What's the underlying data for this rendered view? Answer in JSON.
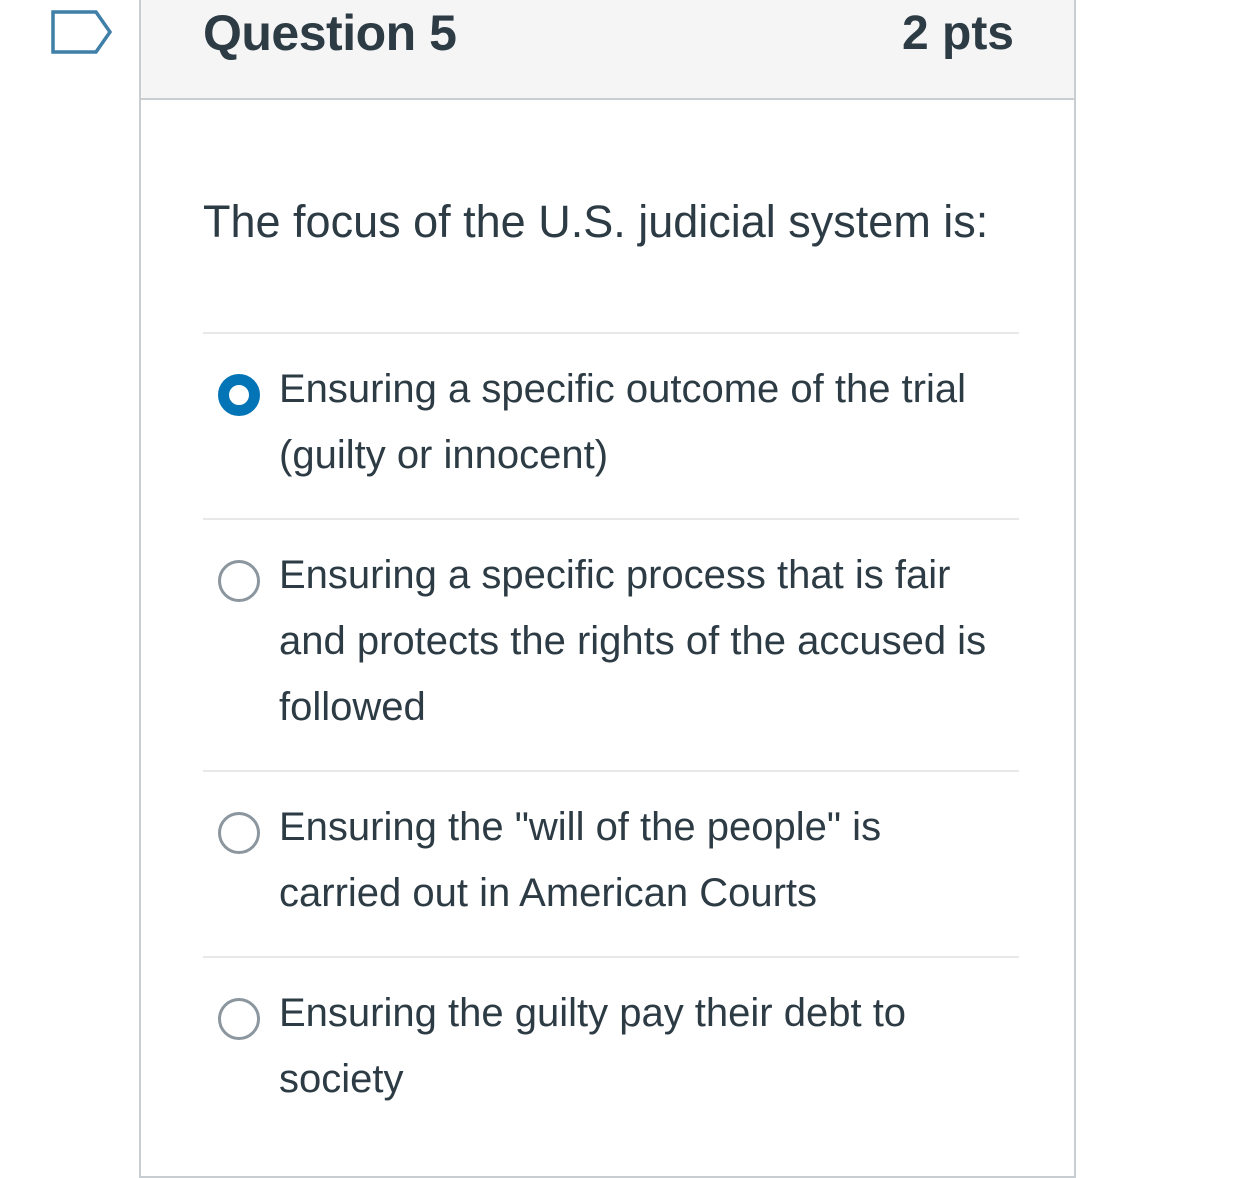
{
  "question": {
    "title": "Question 5",
    "points": "2 pts",
    "text": "The focus of the U.S. judicial system is:",
    "flag_icon": "bookmark-flag-icon"
  },
  "answers": [
    {
      "label": "Ensuring a specific outcome of the trial (guilty or innocent)",
      "selected": true
    },
    {
      "label": "Ensuring a specific process that is fair and protects the rights of the accused is followed",
      "selected": false
    },
    {
      "label": "Ensuring the \"will of the people\" is carried out in American Courts",
      "selected": false
    },
    {
      "label": "Ensuring the guilty pay their debt to society",
      "selected": false
    }
  ],
  "colors": {
    "accent": "#0374b5",
    "text": "#2d3b45",
    "header_bg": "#f5f5f5",
    "border": "#c7cdd1"
  }
}
